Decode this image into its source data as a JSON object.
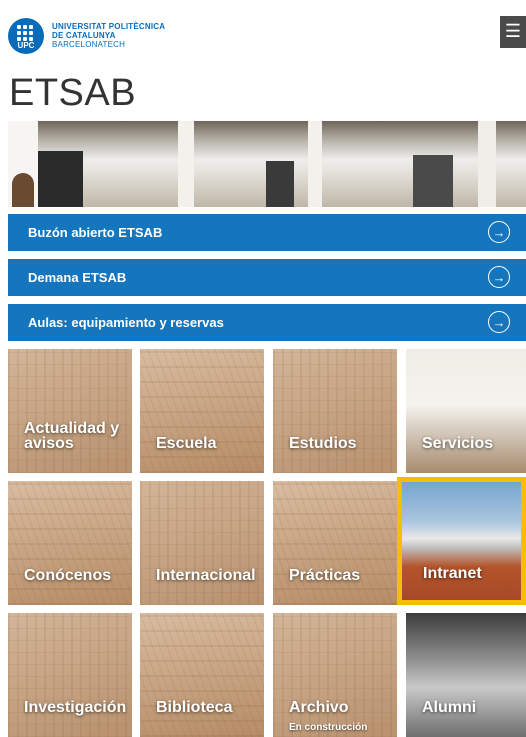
{
  "header": {
    "logo_abbr": "UPC",
    "logo_lines": [
      "UNIVERSITAT POLITÈCNICA",
      "DE CATALUNYA",
      "BARCELONATECH"
    ],
    "menu_glyph": "☰",
    "menu_icon": "hamburger-icon"
  },
  "page_title": "ETSAB",
  "links": [
    {
      "label": "Buzón abierto ETSAB",
      "icon": "arrow-right-circle-icon",
      "arrow": "→"
    },
    {
      "label": "Demana ETSAB",
      "icon": "arrow-right-circle-icon",
      "arrow": "→"
    },
    {
      "label": "Aulas: equipamiento y reservas",
      "icon": "arrow-right-circle-icon",
      "arrow": "→"
    }
  ],
  "tiles": [
    {
      "label": "Actualidad y",
      "label2": "avisos"
    },
    {
      "label": "Escuela"
    },
    {
      "label": "Estudios"
    },
    {
      "label": "Servicios"
    },
    {
      "label": "Conócenos"
    },
    {
      "label": "Internacional"
    },
    {
      "label": "Prácticas"
    },
    {
      "label": "Intranet",
      "selected": true
    },
    {
      "label": "Investigación"
    },
    {
      "label": "Biblioteca"
    },
    {
      "label": "Archivo",
      "sublabel": "En construcción"
    },
    {
      "label": "Alumni"
    }
  ],
  "colors": {
    "brand": "#0a6cb8",
    "link_bar": "#1576be",
    "highlight": "#f6be00"
  }
}
